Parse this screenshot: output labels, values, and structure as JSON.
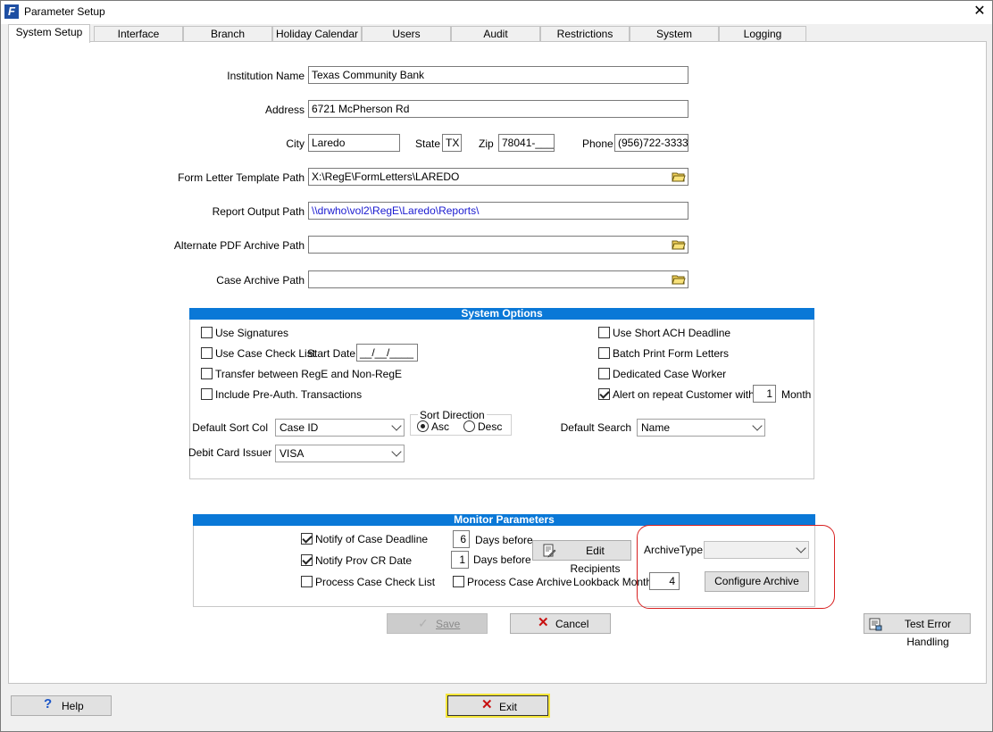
{
  "window": {
    "title": "Parameter Setup",
    "close_glyph": "✕"
  },
  "tabs": [
    {
      "label": "System Setup"
    },
    {
      "label": "Interface"
    },
    {
      "label": "Branch"
    },
    {
      "label": "Holiday Calendar"
    },
    {
      "label": "Users"
    },
    {
      "label": "Audit"
    },
    {
      "label": "Restrictions"
    },
    {
      "label": "System"
    },
    {
      "label": "Logging"
    }
  ],
  "form": {
    "institution_name_label": "Institution Name",
    "institution_name": "Texas Community Bank",
    "address_label": "Address",
    "address": "6721 McPherson Rd",
    "city_label": "City",
    "city": "Laredo",
    "state_label": "State",
    "state": "TX",
    "zip_label": "Zip",
    "zip": "78041-____",
    "phone_label": "Phone",
    "phone": "(956)722-3333",
    "form_letter_label": "Form Letter Template Path",
    "form_letter_path": "X:\\RegE\\FormLetters\\LAREDO",
    "report_output_label": "Report Output Path",
    "report_output_path": "\\\\drwho\\vol2\\RegE\\Laredo\\Reports\\",
    "alt_pdf_label": "Alternate PDF Archive Path",
    "alt_pdf_path": "",
    "case_archive_label": "Case Archive Path",
    "case_archive_path": ""
  },
  "system_options": {
    "title": "System Options",
    "use_signatures": "Use Signatures",
    "use_case_check_list": "Use Case Check List",
    "start_date_label": "Start Date",
    "start_date": "__/__/____",
    "transfer": "Transfer between RegE and Non-RegE",
    "include_preauth": "Include Pre-Auth. Transactions",
    "use_short_ach": "Use Short ACH Deadline",
    "batch_print": "Batch Print Form Letters",
    "dedicated_worker": "Dedicated Case Worker",
    "alert_repeat": "Alert on repeat Customer within",
    "alert_months": "1",
    "month_label": "Month",
    "default_sort_label": "Default Sort Col",
    "default_sort_value": "Case ID",
    "sort_direction_label": "Sort Direction",
    "asc_label": "Asc",
    "desc_label": "Desc",
    "default_search_label": "Default Search",
    "default_search_value": "Name",
    "debit_issuer_label": "Debit Card Issuer",
    "debit_issuer_value": "VISA"
  },
  "monitor": {
    "title": "Monitor Parameters",
    "notify_deadline": "Notify of Case Deadline",
    "deadline_days": "6",
    "days_before_1": "Days before",
    "notify_prov": "Notify Prov CR Date",
    "prov_days": "1",
    "days_before_2": "Days before",
    "edit_recipients": "Edit Recipients",
    "process_check_list": "Process Case Check List",
    "process_archive": "Process Case Archive",
    "lookback_label": "Lookback Month",
    "lookback_value": "4",
    "archive_type_label": "ArchiveType",
    "archive_type_value": "",
    "configure_archive": "Configure Archive"
  },
  "buttons": {
    "save": "Save",
    "cancel": "Cancel",
    "test_error": "Test Error Handling",
    "help": "Help",
    "exit": "Exit"
  },
  "colors": {
    "accent_bar": "#0a78d7",
    "highlight_border": "#d82020",
    "link_text": "#1a1ad0"
  }
}
